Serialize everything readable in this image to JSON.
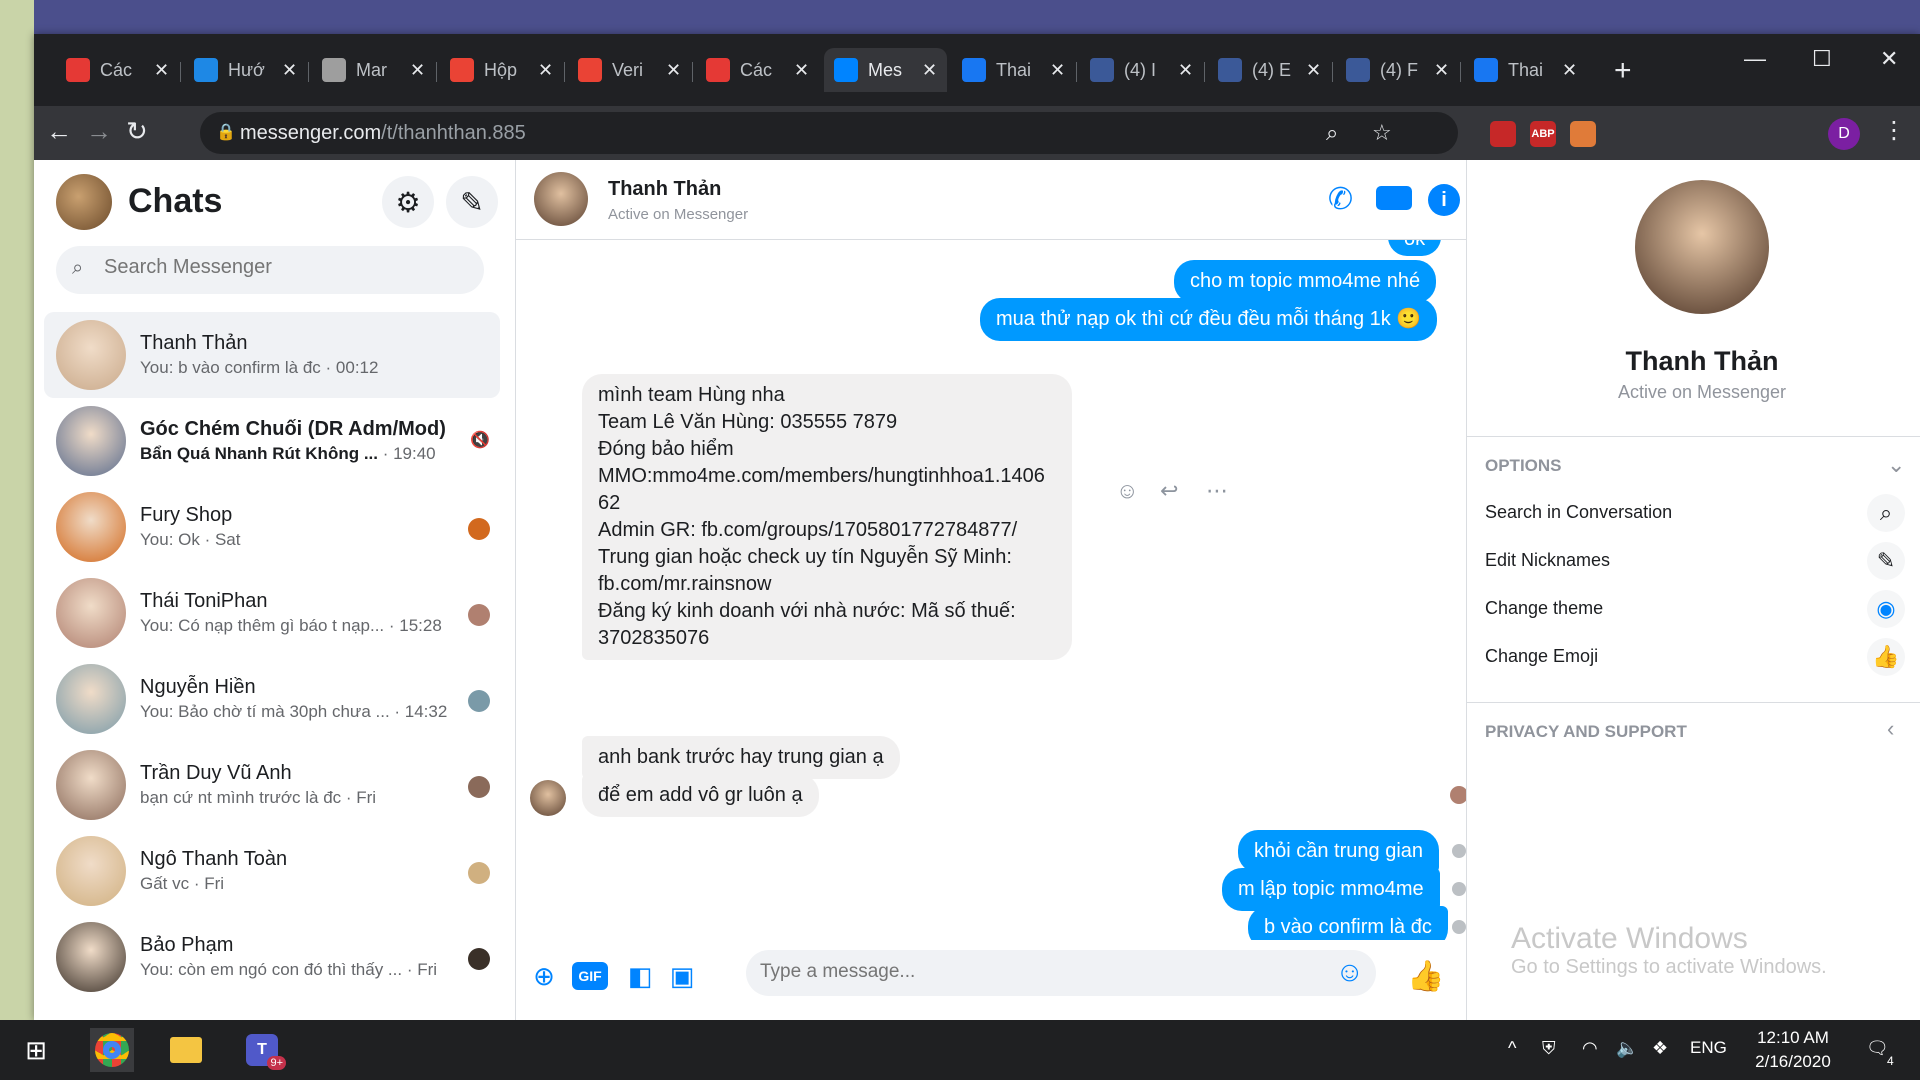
{
  "browser": {
    "tabs": [
      {
        "label": "Các",
        "icon": "red-bolt-icon",
        "color": "#e53935"
      },
      {
        "label": "Hướ",
        "icon": "s-logo-icon",
        "color": "#1e88e5"
      },
      {
        "label": "Mar",
        "icon": "apple-icon",
        "color": "#9e9e9e"
      },
      {
        "label": "Hộp",
        "icon": "gmail-icon",
        "color": "#ea4335"
      },
      {
        "label": "Veri",
        "icon": "gmail-icon",
        "color": "#ea4335"
      },
      {
        "label": "Các",
        "icon": "c-logo-icon",
        "color": "#e53935"
      },
      {
        "label": "Mes",
        "icon": "messenger-icon",
        "color": "#0084ff"
      },
      {
        "label": "Thai",
        "icon": "facebook-icon",
        "color": "#1877f2"
      },
      {
        "label": "(4) I",
        "icon": "tool-icon",
        "color": "#3b5998"
      },
      {
        "label": "(4) E",
        "icon": "tool-icon",
        "color": "#3b5998"
      },
      {
        "label": "(4) F",
        "icon": "tool-icon",
        "color": "#3b5998"
      },
      {
        "label": "Thai",
        "icon": "facebook-icon",
        "color": "#1877f2"
      }
    ],
    "url_host": "messenger.com",
    "url_path": "/t/thanhthan.885",
    "extensions": [
      {
        "label": "",
        "color": "#c62828"
      },
      {
        "label": "ABP",
        "color": "#c62828"
      },
      {
        "label": "",
        "color": "#e07b39"
      }
    ],
    "profile_letter": "D"
  },
  "sidebar": {
    "title": "Chats",
    "search_placeholder": "Search Messenger",
    "chats": [
      {
        "name": "Thanh Thản",
        "preview": "You: b vào confirm là đc · 00:12",
        "time": "",
        "bold": false,
        "avatar_color": "#c9a98a"
      },
      {
        "name": "Góc Chém Chuối (DR Adm/Mod)",
        "preview": "Bẩn Quá Nhanh Rút Không ...",
        "time": " · 19:40",
        "bold": true,
        "avatar_color": "#5a6b8c"
      },
      {
        "name": "Fury Shop",
        "preview": "You: Ok · Sat",
        "time": "",
        "bold": false,
        "avatar_color": "#d2691e"
      },
      {
        "name": "Thái ToniPhan",
        "preview": "You: Có nạp thêm gì báo t nạp... · 15:28",
        "time": "",
        "bold": false,
        "avatar_color": "#b08070"
      },
      {
        "name": "Nguyễn Hiền",
        "preview": "You: Bảo chờ tí mà 30ph chưa ... · 14:32",
        "time": "",
        "bold": false,
        "avatar_color": "#7a9aa8"
      },
      {
        "name": "Trần Duy Vũ Anh",
        "preview": "bạn cứ nt mình trước là đc · Fri",
        "time": "",
        "bold": false,
        "avatar_color": "#8a6a5a"
      },
      {
        "name": "Ngô Thanh Toàn",
        "preview": "Gất vc · Fri",
        "time": "",
        "bold": false,
        "avatar_color": "#d0b080"
      },
      {
        "name": "Bảo Phạm",
        "preview": "You: còn em ngó con đó thì thấy ... · Fri",
        "time": "",
        "bold": false,
        "avatar_color": "#3a3028"
      }
    ]
  },
  "conversation": {
    "name": "Thanh Thản",
    "status": "Active on Messenger",
    "partial_top": "ok",
    "messages_out_top": [
      "cho m topic mmo4me nhé",
      "mua thử nạp ok thì cứ đều đều mỗi tháng 1k 🙂"
    ],
    "long_message_lines": [
      "mình team Hùng nha",
      "Team Lê Văn Hùng: 035555 7879",
      "Đóng bảo hiểm",
      "MMO:mmo4me.com/members/hungtinhhoa1.1406",
      "62",
      "Admin GR: fb.com/groups/1705801772784877/",
      "Trung gian hoặc check uy tín Nguyễn Sỹ Minh:",
      "fb.com/mr.rainsnow",
      "Đăng ký kinh doanh với nhà nước: Mã số thuế:",
      "3702835076"
    ],
    "messages_in": [
      "anh bank trước hay trung gian ạ",
      "để em add vô gr luôn ạ"
    ],
    "messages_out_bottom": [
      "khỏi cần trung gian",
      "m lập topic mmo4me",
      "b vào confirm là đc"
    ],
    "composer_placeholder": "Type a message..."
  },
  "info": {
    "name": "Thanh Thản",
    "status": "Active on Messenger",
    "options_header": "OPTIONS",
    "options": [
      {
        "label": "Search in Conversation",
        "icon": "search-icon"
      },
      {
        "label": "Edit Nicknames",
        "icon": "pencil-icon"
      },
      {
        "label": "Change theme",
        "icon": "theme-circle-icon"
      },
      {
        "label": "Change Emoji",
        "icon": "thumbs-up-icon"
      }
    ],
    "privacy_header": "PRIVACY AND SUPPORT",
    "watermark_title": "Activate Windows",
    "watermark_sub": "Go to Settings to activate Windows."
  },
  "taskbar": {
    "lang": "ENG",
    "time": "12:10 AM",
    "date": "2/16/2020",
    "notif_count": "4",
    "teams_badge": "9+"
  },
  "colors": {
    "messenger_blue": "#0099ff",
    "accent": "#0084ff"
  }
}
